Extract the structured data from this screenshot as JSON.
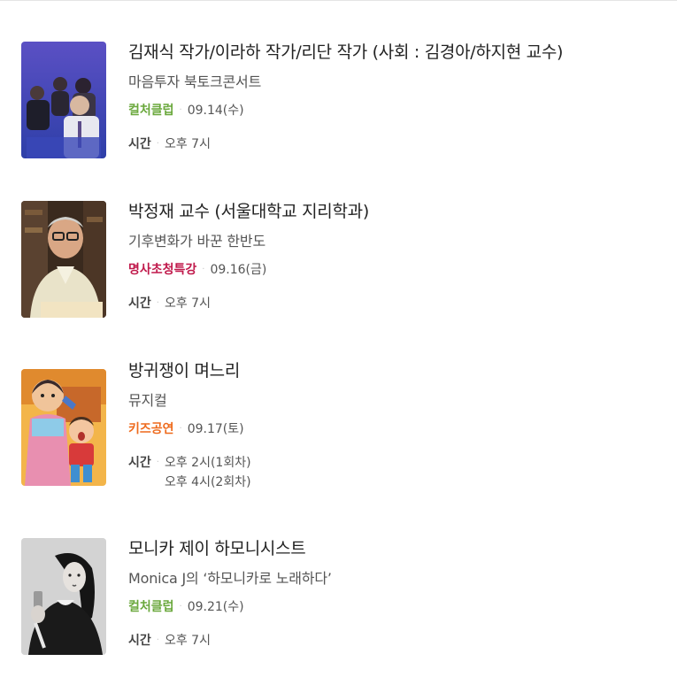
{
  "events": [
    {
      "title": "김재식 작가/이라하 작가/리단 작가 (사회 : 김경아/하지현 교수)",
      "subtitle": "마음투자 북토크콘서트",
      "category": "컬처클럽",
      "category_color": "#6aa83c",
      "date": "09.14(수)",
      "time_label": "시간",
      "times": [
        "오후 7시"
      ]
    },
    {
      "title": "박정재 교수 (서울대학교 지리학과)",
      "subtitle": "기후변화가 바꾼 한반도",
      "category": "명사초청특강",
      "category_color": "#c0194b",
      "date": "09.16(금)",
      "time_label": "시간",
      "times": [
        "오후 7시"
      ]
    },
    {
      "title": "방귀쟁이 며느리",
      "subtitle": "뮤지컬",
      "category": "키즈공연",
      "category_color": "#ee6a1c",
      "date": "09.17(토)",
      "time_label": "시간",
      "times": [
        "오후 2시(1회차)",
        "오후 4시(2회차)"
      ]
    },
    {
      "title": "모니카 제이 하모니시스트",
      "subtitle": "Monica J의 ‘하모니카로 노래하다’",
      "category": "컬처클럽",
      "category_color": "#6aa83c",
      "date": "09.21(수)",
      "time_label": "시간",
      "times": [
        "오후 7시"
      ]
    }
  ]
}
